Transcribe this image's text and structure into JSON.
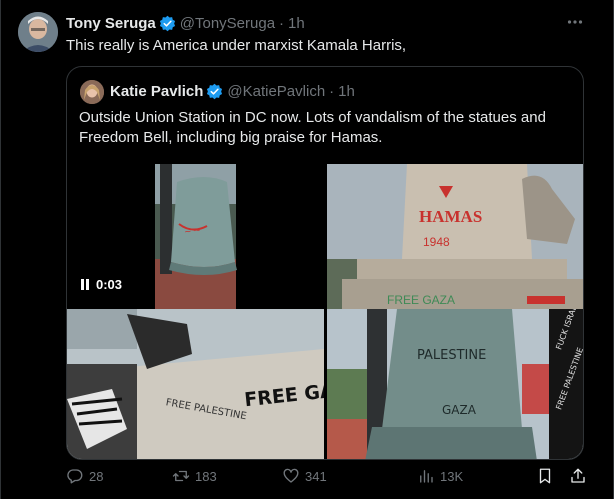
{
  "post": {
    "author_name": "Tony Seruga",
    "author_handle": "@TonySeruga",
    "separator": "·",
    "time": "1h",
    "text": "This really is America under marxist Kamala Harris,"
  },
  "quote": {
    "author_name": "Katie Pavlich",
    "author_handle": "@KatiePavlich",
    "separator": "·",
    "time": "1h",
    "text": "Outside Union Station in DC now. Lots of vandalism of the statues and Freedom Bell, including big praise for Hamas.",
    "video_time": "0:03",
    "media_text": {
      "statue_hamas": "HAMAS",
      "statue_1948": "1948",
      "statue_free_gaza": "FREE GAZA",
      "wall_free_gaza": "FREE GAZA",
      "wall_free_palestine": "FREE PALESTINE",
      "sign_fuck_israel": "FUCK ISRAEL",
      "sign_free_palestine": "FREE PALESTINE",
      "bell_gaza": "GAZA",
      "bell_palestine": "PALESTINE"
    }
  },
  "actions": {
    "replies": "28",
    "reposts": "183",
    "likes": "341",
    "views": "13K"
  },
  "colors": {
    "background": "#000000",
    "text": "#e7e9ea",
    "muted": "#71767b",
    "verified": "#1d9bf0",
    "border": "#2f3336",
    "graffiti_red": "#c8322e"
  }
}
